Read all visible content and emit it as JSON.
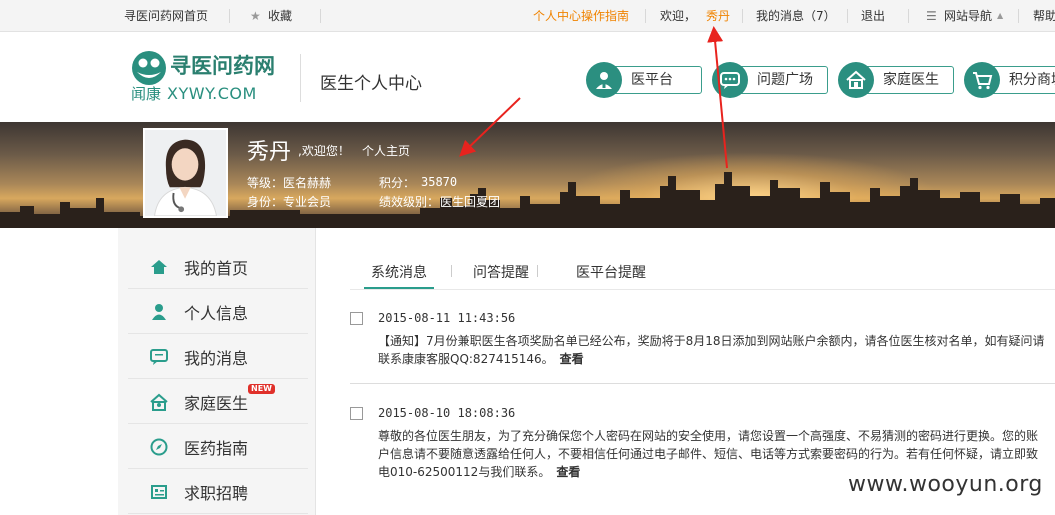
{
  "topbar": {
    "home_link": "寻医问药网首页",
    "favorite": "收藏",
    "guide": "个人中心操作指南",
    "welcome": "欢迎，",
    "username": "秀丹",
    "messages": "我的消息（7）",
    "logout": "退出",
    "site_nav": "网站导航",
    "help": "帮助"
  },
  "logo": {
    "cn": "寻医问药网",
    "sub": "闻康",
    "en": "XYWY.COM"
  },
  "header": {
    "title": "医生个人中心",
    "nav": [
      {
        "label": "医平台",
        "icon": "doctor-icon"
      },
      {
        "label": "问题广场",
        "icon": "chat-icon"
      },
      {
        "label": "家庭医生",
        "icon": "house-icon"
      },
      {
        "label": "积分商城",
        "icon": "cart-icon"
      }
    ]
  },
  "profile": {
    "name": "秀丹",
    "welcome": ",欢迎您！",
    "homepage": "个人主页",
    "level_label": "等级：",
    "level_value": "医名赫赫",
    "points_label": "积分：",
    "points_value": "35870",
    "identity_label": "身份：",
    "identity_value": "专业会员",
    "perf_label": "绩效级别：",
    "perf_value": "医生回夏团"
  },
  "sidebar": {
    "items": [
      {
        "label": "我的首页",
        "icon": "home-icon"
      },
      {
        "label": "个人信息",
        "icon": "user-icon"
      },
      {
        "label": "我的消息",
        "icon": "message-icon"
      },
      {
        "label": "家庭医生",
        "icon": "family-doctor-icon",
        "badge": "NEW"
      },
      {
        "label": "医药指南",
        "icon": "compass-icon"
      },
      {
        "label": "求职招聘",
        "icon": "job-icon"
      }
    ]
  },
  "tabs": [
    {
      "label": "系统消息",
      "active": true
    },
    {
      "label": "问答提醒",
      "active": false
    },
    {
      "label": "医平台提醒",
      "active": false
    }
  ],
  "messages": [
    {
      "date": "2015-08-11 11:43:56",
      "body": "【通知】7月份兼职医生各项奖励名单已经公布，奖励将于8月18日添加到网站账户余额内，请各位医生核对名单，如有疑问请联系康康客服QQ:827415146。",
      "view": "查看"
    },
    {
      "date": "2015-08-10 18:08:36",
      "body": "尊敬的各位医生朋友，为了充分确保您个人密码在网站的安全使用，请您设置一个高强度、不易猜测的密码进行更换。您的账户信息请不要随意透露给任何人，不要相信任何通过电子邮件、短信、电话等方式索要密码的行为。若有任何怀疑，请立即致电010-62500112与我们联系。",
      "view": "查看"
    }
  ],
  "watermark": "www.wooyun.org",
  "colors": {
    "accent": "#2a9d8c",
    "orange": "#f08300",
    "annotation": "#e8231e"
  }
}
